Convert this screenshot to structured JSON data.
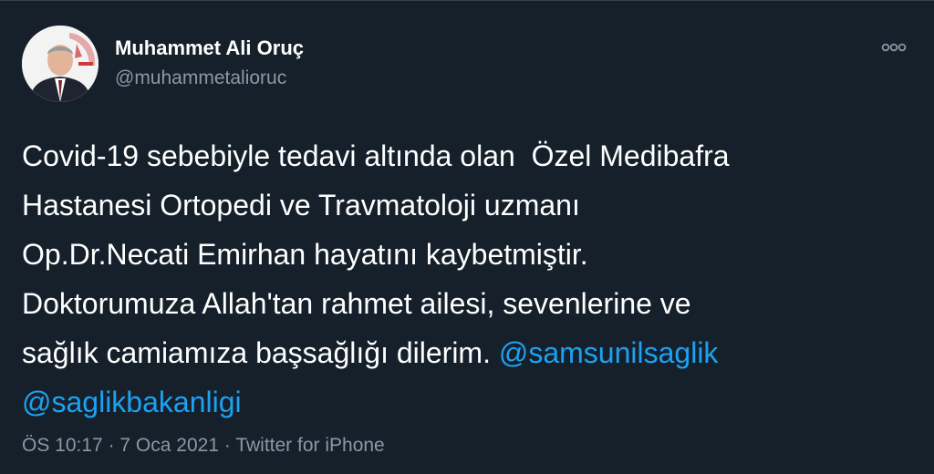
{
  "tweet": {
    "author": {
      "display_name": "Muhammet Ali Oruç",
      "handle": "@muhammetalioruc"
    },
    "text_lines": [
      "Covid-19 sebebiyle tedavi altında olan  Özel Medibafra",
      "Hastanesi Ortopedi ve Travmatoloji uzmanı",
      "Op.Dr.Necati Emirhan hayatını kaybetmiştir.",
      "Doktorumuza Allah'tan rahmet ailesi, sevenlerine ve",
      "sağlık camiamıza başsağlığı dilerim."
    ],
    "mentions": [
      "@samsunilsaglik",
      "@saglikbakanligi"
    ],
    "time": "ÖS 10:17",
    "date": "7 Oca 2021",
    "separator": "·",
    "source": "Twitter for iPhone",
    "icons": {
      "more": "more-horizontal-icon",
      "avatar": "profile-photo"
    },
    "colors": {
      "background": "#15202b",
      "text": "#ffffff",
      "secondary_text": "#8899a6",
      "link": "#1da1f2"
    }
  }
}
